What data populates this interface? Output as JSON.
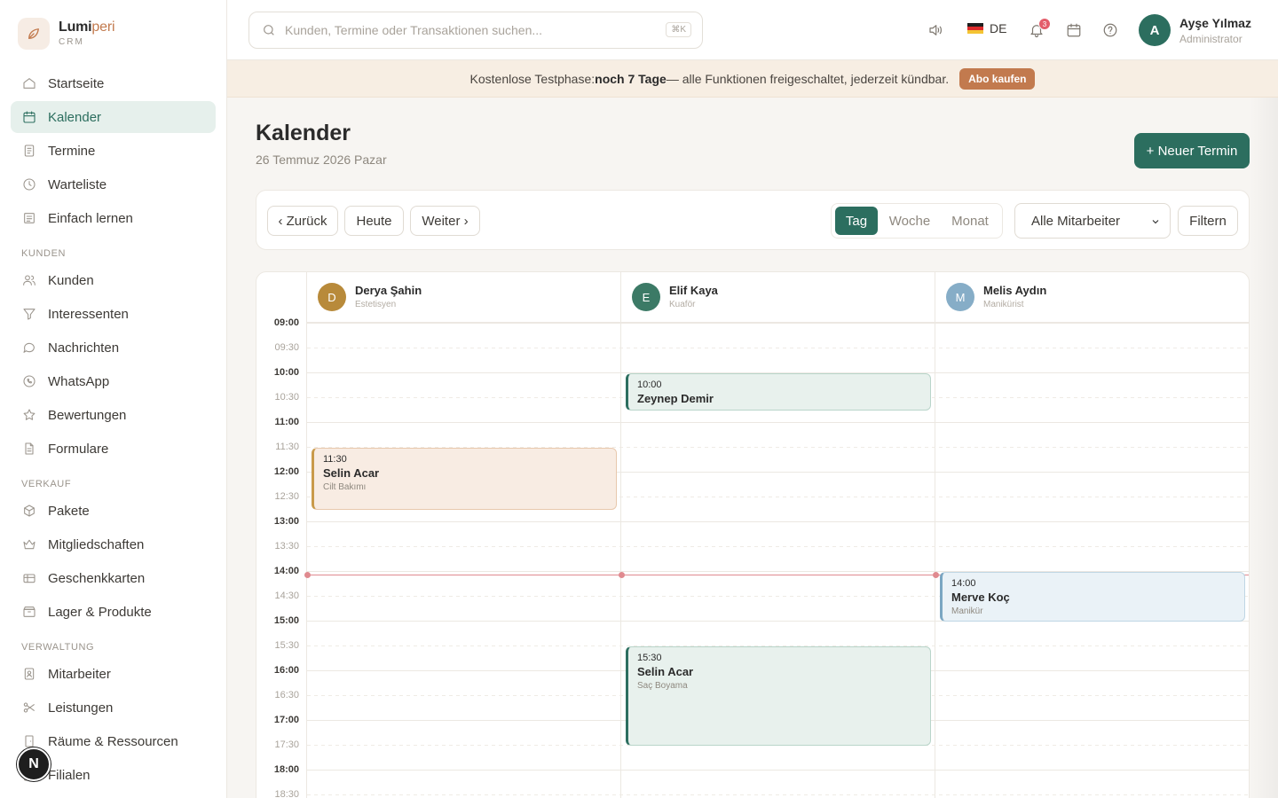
{
  "brand": {
    "name_main": "Lumi",
    "name_accent": "peri",
    "sub": "CRM"
  },
  "sidebar": {
    "top_items": [
      {
        "label": "Startseite",
        "icon": "home-icon"
      },
      {
        "label": "Kalender",
        "icon": "calendar-icon",
        "active": true
      },
      {
        "label": "Termine",
        "icon": "clipboard-icon"
      },
      {
        "label": "Warteliste",
        "icon": "clock-icon"
      },
      {
        "label": "Einfach lernen",
        "icon": "book-icon"
      }
    ],
    "section_kunden": "KUNDEN",
    "kunden_items": [
      {
        "label": "Kunden",
        "icon": "users-icon"
      },
      {
        "label": "Interessenten",
        "icon": "funnel-icon"
      },
      {
        "label": "Nachrichten",
        "icon": "chat-icon"
      },
      {
        "label": "WhatsApp",
        "icon": "whatsapp-icon"
      },
      {
        "label": "Bewertungen",
        "icon": "star-icon"
      },
      {
        "label": "Formulare",
        "icon": "document-icon"
      }
    ],
    "section_verkauf": "VERKAUF",
    "verkauf_items": [
      {
        "label": "Pakete",
        "icon": "package-icon"
      },
      {
        "label": "Mitgliedschaften",
        "icon": "crown-icon"
      },
      {
        "label": "Geschenkkarten",
        "icon": "gift-icon"
      },
      {
        "label": "Lager & Produkte",
        "icon": "box-icon"
      }
    ],
    "section_verwaltung": "VERWALTUNG",
    "verwaltung_items": [
      {
        "label": "Mitarbeiter",
        "icon": "id-badge-icon"
      },
      {
        "label": "Leistungen",
        "icon": "scissors-icon"
      },
      {
        "label": "Räume & Ressourcen",
        "icon": "door-icon"
      },
      {
        "label": "Filialen",
        "icon": "building-icon"
      }
    ],
    "fab_letter": "N"
  },
  "topbar": {
    "search_placeholder": "Kunden, Termine oder Transaktionen suchen...",
    "search_shortcut": "⌘K",
    "language": "DE",
    "notification_count": "3",
    "user_initial": "A",
    "user_name": "Ayşe Yılmaz",
    "user_role": "Administrator"
  },
  "banner": {
    "prefix": "Kostenlose Testphase: ",
    "highlight": "noch 7 Tage",
    "suffix": " — alle Funktionen freigeschaltet, jederzeit kündbar.",
    "button": "Abo kaufen"
  },
  "page": {
    "title": "Kalender",
    "date": "26 Temmuz 2026 Pazar",
    "new_button": "+ Neuer Termin"
  },
  "toolbar": {
    "back": "‹ Zurück",
    "today": "Heute",
    "next": "Weiter ›",
    "view_day": "Tag",
    "view_week": "Woche",
    "view_month": "Monat",
    "staff_select": "Alle Mitarbeiter",
    "filter": "Filtern"
  },
  "calendar": {
    "staff": [
      {
        "initial": "D",
        "name": "Derya Şahin",
        "role": "Estetisyen",
        "color": "#b88a3a"
      },
      {
        "initial": "E",
        "name": "Elif Kaya",
        "role": "Kuaför",
        "color": "#3c7a66"
      },
      {
        "initial": "M",
        "name": "Melis Aydın",
        "role": "Manikürist",
        "color": "#86adc7"
      }
    ],
    "times": [
      "09:00",
      "09:30",
      "10:00",
      "10:30",
      "11:00",
      "11:30",
      "12:00",
      "12:30",
      "13:00",
      "13:30",
      "14:00",
      "14:30",
      "15:00",
      "15:30",
      "16:00",
      "16:30",
      "17:00",
      "17:30",
      "18:00",
      "18:30"
    ],
    "events": [
      {
        "time": "10:00",
        "name": "Zeynep Demir",
        "service": "",
        "col": 1
      },
      {
        "time": "11:30",
        "name": "Selin Acar",
        "service": "Cilt Bakımı",
        "col": 0
      },
      {
        "time": "14:00",
        "name": "Merve Koç",
        "service": "Manikür",
        "col": 2
      },
      {
        "time": "15:30",
        "name": "Selin Acar",
        "service": "Saç Boyama",
        "col": 1
      }
    ]
  }
}
